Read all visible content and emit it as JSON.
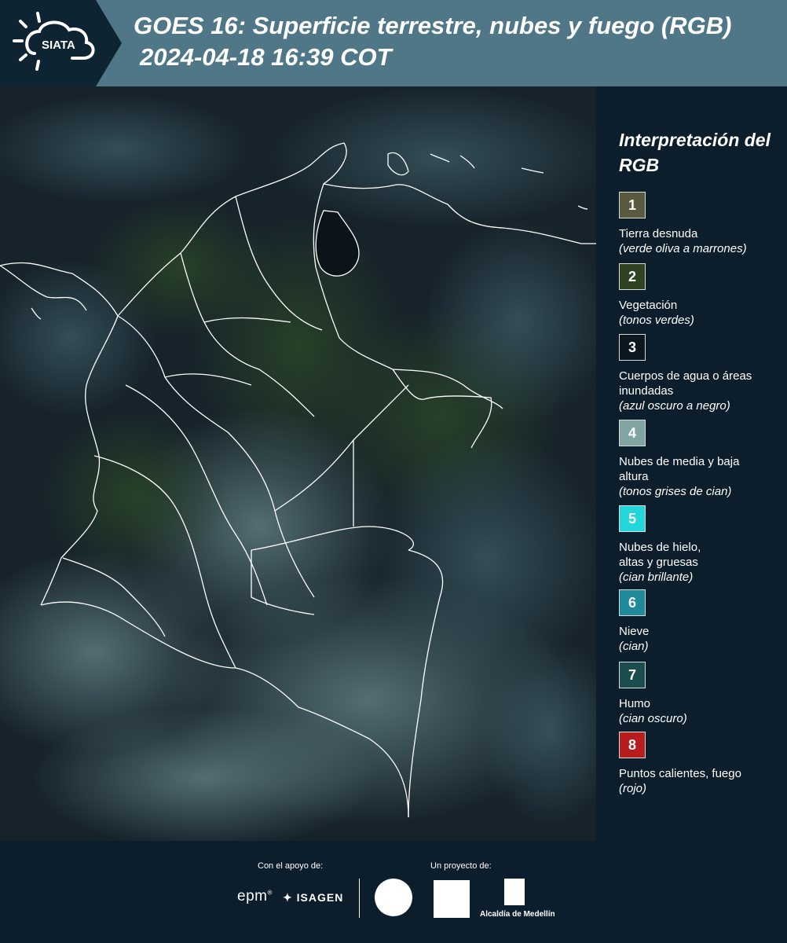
{
  "header": {
    "logo_text": "SIATA",
    "title": "GOES 16: Superficie terrestre, nubes y fuego (RGB)",
    "subtitle": "2024-04-18 16:39 COT"
  },
  "legend": {
    "title": "Interpretación del RGB",
    "items": [
      {
        "num": "1",
        "color": "#5a5a41",
        "label": "Tierra desnuda",
        "note": "(verde oliva a marrones)"
      },
      {
        "num": "2",
        "color": "#2f4322",
        "label": "Vegetación",
        "note": "(tonos verdes)"
      },
      {
        "num": "3",
        "color": "#0b1820",
        "label": "Cuerpos de agua o áreas inundadas",
        "note": "(azul oscuro a negro)"
      },
      {
        "num": "4",
        "color": "#7fa4a2",
        "label": "Nubes de media y baja altura",
        "note": "(tonos grises de cian)"
      },
      {
        "num": "5",
        "color": "#22d6d9",
        "label": "Nubes de hielo, altas y gruesas",
        "note": "(cian brillante)"
      },
      {
        "num": "6",
        "color": "#1f8a9a",
        "label": "Nieve",
        "note": "(cian)"
      },
      {
        "num": "7",
        "color": "#1b4d4f",
        "label": "Humo",
        "note": "(cian oscuro)"
      },
      {
        "num": "8",
        "color": "#b81d1d",
        "label": "Puntos calientes, fuego",
        "note": "(rojo)"
      }
    ]
  },
  "footer": {
    "support_label": "Con el apoyo de:",
    "project_label": "Un proyecto de:",
    "epm": "epm",
    "isagen": "ISAGEN",
    "alcaldia": "Alcaldía de Medellín"
  }
}
